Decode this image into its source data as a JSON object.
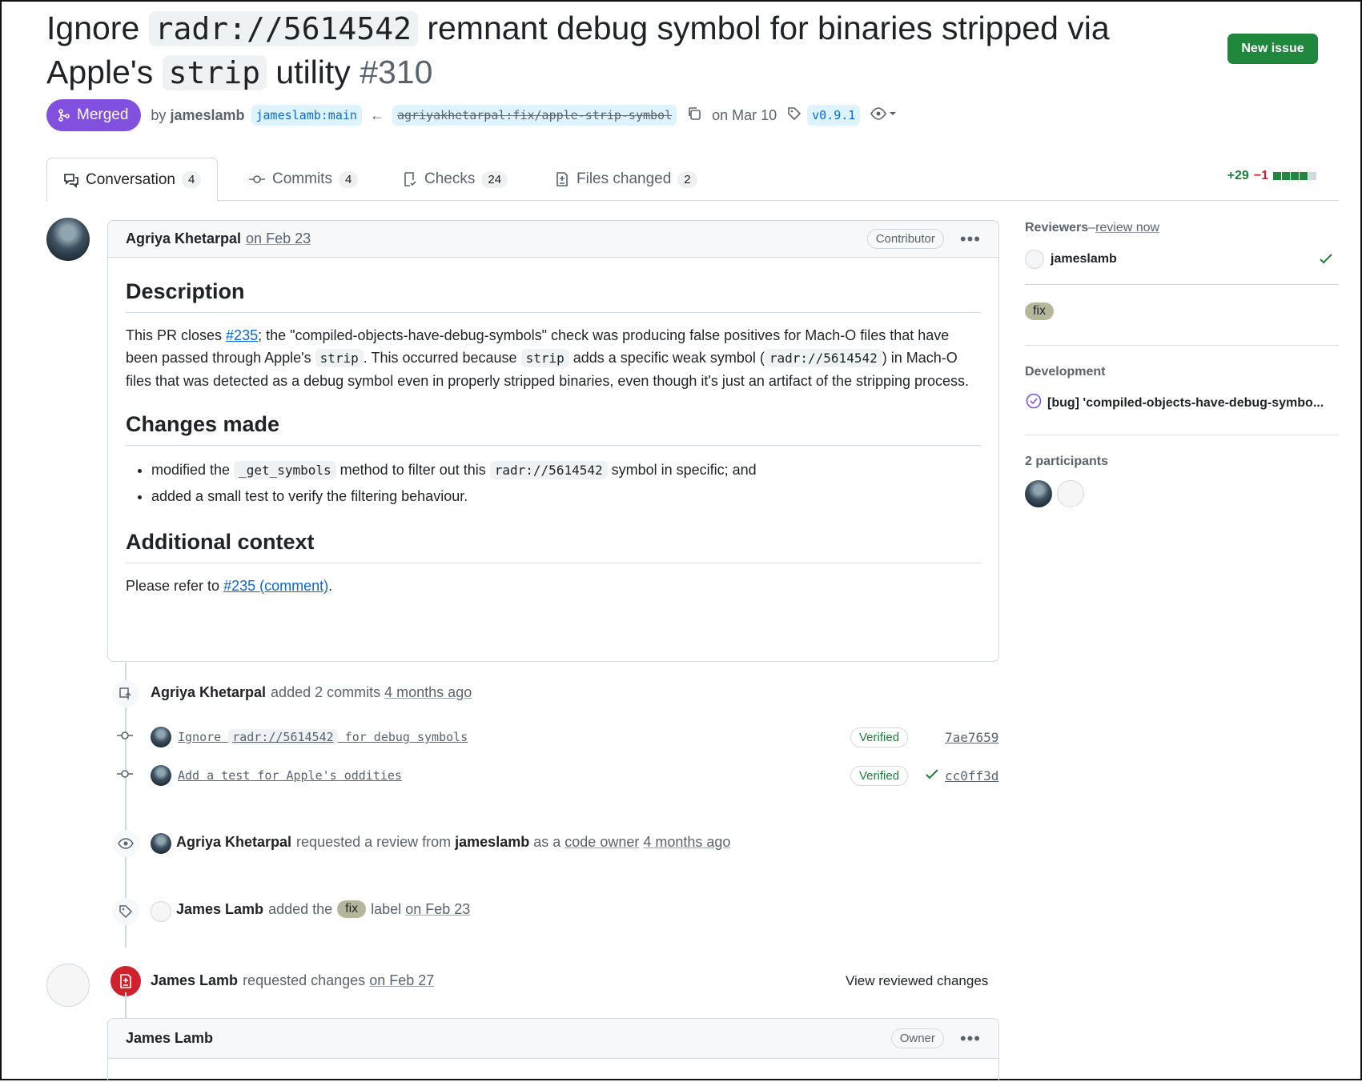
{
  "title": {
    "pre": "Ignore ",
    "code": "radr://5614542",
    "mid": " remnant debug symbol for binaries stripped via Apple's ",
    "code2": "strip",
    "post": " utility ",
    "number": "#310"
  },
  "new_issue_label": "New issue",
  "meta": {
    "state": "Merged",
    "by": "by",
    "author": "jameslamb",
    "base_branch": "jameslamb:main",
    "head_branch": "agriyakhetarpal:fix/apple-strip-symbol",
    "date": "on Mar 10",
    "tag": "v0.9.1"
  },
  "tabs": [
    {
      "label": "Conversation",
      "count": "4"
    },
    {
      "label": "Commits",
      "count": "4"
    },
    {
      "label": "Checks",
      "count": "24"
    },
    {
      "label": "Files changed",
      "count": "2"
    }
  ],
  "diffstat": {
    "additions": "+29",
    "deletions": "−1"
  },
  "comment": {
    "author": "Agriya Khetarpal",
    "date": "on Feb 23",
    "role": "Contributor",
    "h_description": "Description",
    "p1_a": "This PR closes ",
    "p1_link": "#235",
    "p1_b": "; the \"compiled-objects-have-debug-symbols\" check was producing false positives for Mach-O files that have been passed through Apple's ",
    "p1_code1": "strip",
    "p1_c": ". This occurred because ",
    "p1_code2": "strip",
    "p1_d": " adds a specific weak symbol (",
    "p1_code3": "radr://5614542",
    "p1_e": ") in Mach-O files that was detected as a debug symbol even in properly stripped binaries, even though it's just an artifact of the stripping process.",
    "h_changes": "Changes made",
    "li1_a": "modified the ",
    "li1_code1": "_get_symbols",
    "li1_b": " method to filter out this ",
    "li1_code2": "radr://5614542",
    "li1_c": " symbol in specific; and",
    "li2": "added a small test to verify the filtering behaviour.",
    "h_context": "Additional context",
    "p3_a": "Please refer to ",
    "p3_link": "#235 (comment)",
    "p3_b": "."
  },
  "timeline": {
    "commits_event": {
      "actor": "Agriya Khetarpal",
      "action": "added 2 commits",
      "time": "4 months ago"
    },
    "commits": [
      {
        "msg_pre": "Ignore ",
        "msg_code": "radr://5614542",
        "msg_post": " for debug symbols",
        "verified": "Verified",
        "sha": "7ae7659"
      },
      {
        "msg": "Add a test for Apple's oddities",
        "verified": "Verified",
        "sha": "cc0ff3d"
      }
    ],
    "review_request": {
      "actor": "Agriya Khetarpal",
      "action": "requested a review from",
      "target": "jameslamb",
      "as": "as a",
      "role_link": "code owner",
      "time": "4 months ago"
    },
    "label_event": {
      "actor": "James Lamb",
      "action": "added the",
      "label": "fix",
      "suffix": "label",
      "time": "on Feb 23"
    },
    "changes_event": {
      "actor": "James Lamb",
      "action": "requested changes",
      "time": "on Feb 27",
      "view": "View reviewed changes"
    }
  },
  "comment2": {
    "author": "James Lamb",
    "role": "Owner"
  },
  "sidebar": {
    "reviewers_heading": "Reviewers",
    "reviewers_sep": " – ",
    "review_now": "review now",
    "reviewer": "jameslamb",
    "label": "fix",
    "development_heading": "Development",
    "linked_issue": "[bug] 'compiled-objects-have-debug-symbo...",
    "participants_heading": "2 participants"
  },
  "colors": {
    "merged": "#8250df",
    "green": "#1f883d",
    "danger": "#cf222e",
    "link": "#0969da",
    "label_fix": "#b6b79a"
  }
}
